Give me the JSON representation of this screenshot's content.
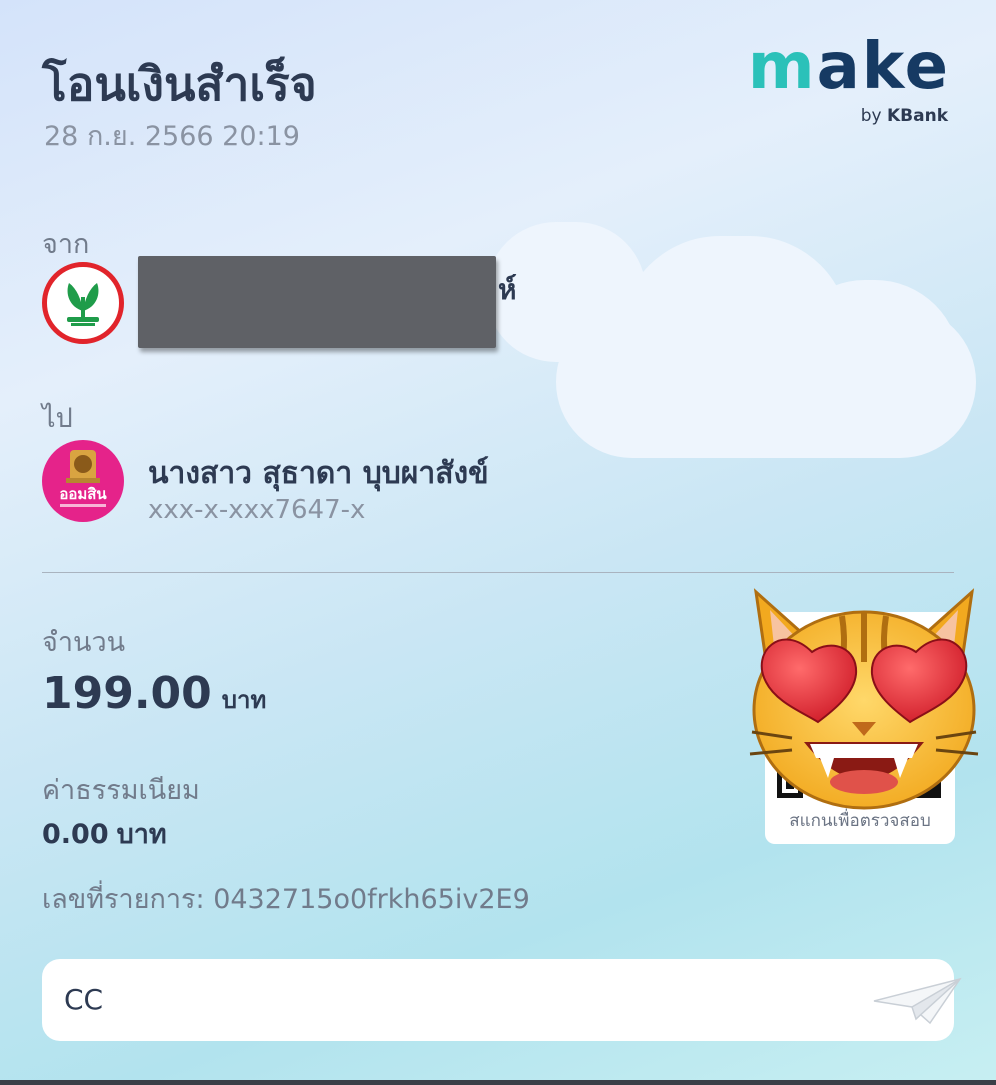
{
  "header": {
    "title": "โอนเงินสำเร็จ",
    "datetime": "28 ก.ย. 2566 20:19"
  },
  "logo": {
    "word_m": "m",
    "word_rest": "ake",
    "by_text": "by",
    "bank_name": "KBank"
  },
  "from": {
    "label": "จาก",
    "name_visible_tail": "ห์",
    "bank_icon": "kbank-logo-icon"
  },
  "to": {
    "label": "ไป",
    "name": "นางสาว สุธาดา บุบผาสังข์",
    "account": "xxx-x-xxx7647-x",
    "bank_icon": "gsb-logo-icon",
    "bank_logo_text": "ออมสิน"
  },
  "amount": {
    "label": "จำนวน",
    "value": "199.00",
    "unit": "บาท"
  },
  "fee": {
    "label": "ค่าธรรมเนียม",
    "value": "0.00",
    "unit": "บาท"
  },
  "transaction": {
    "ref": "เลขที่รายการ: 0432715o0frkh65iv2E9"
  },
  "qr": {
    "caption": "สแกนเพื่อตรวจสอบ"
  },
  "note": {
    "text": "CC",
    "icon": "paper-plane-icon"
  },
  "colors": {
    "brand_teal": "#2bc1b9",
    "brand_navy": "#163a63",
    "kbank_green": "#1f9c4a",
    "kbank_red": "#e1242b",
    "gsb_pink": "#e5238a"
  }
}
